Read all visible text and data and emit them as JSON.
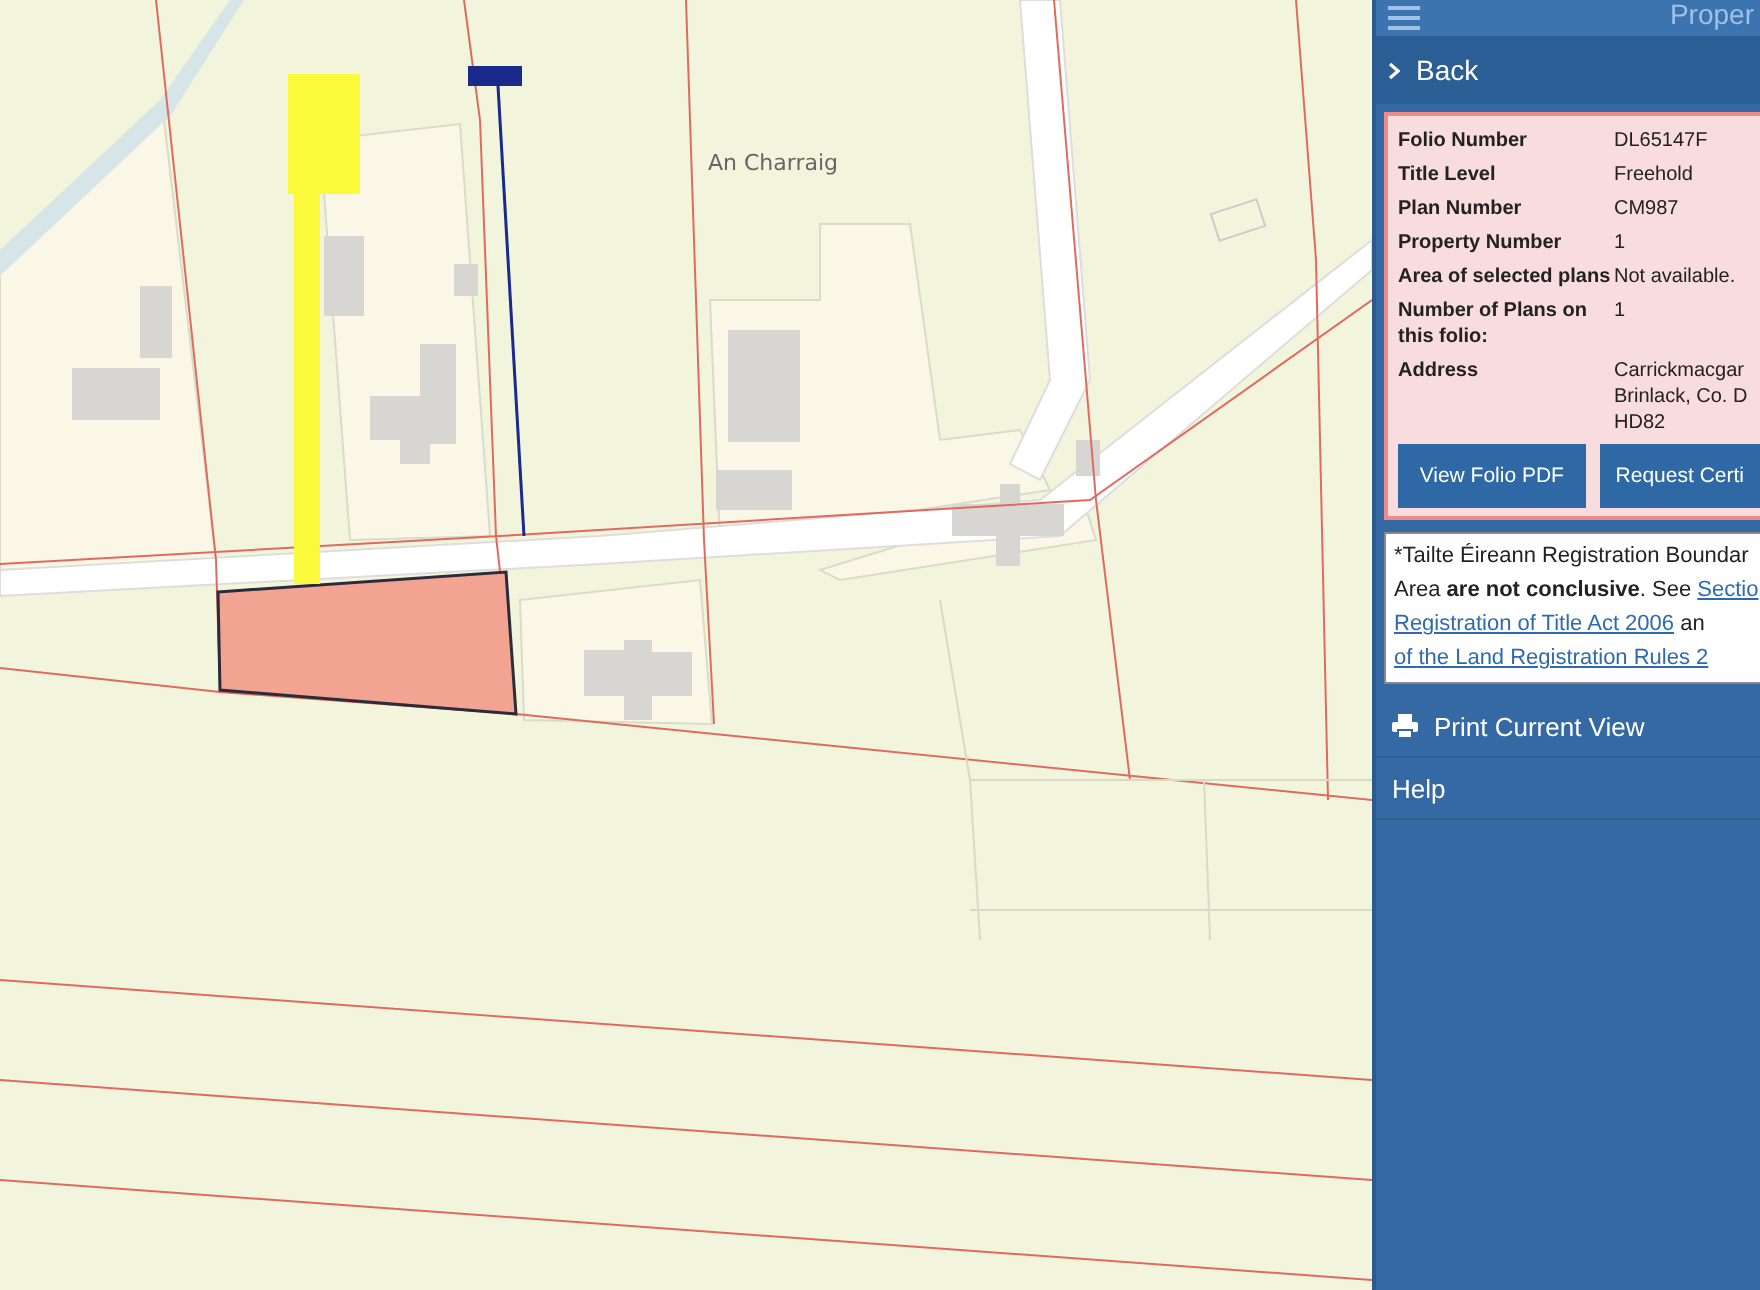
{
  "map": {
    "place_label": "An Charraig"
  },
  "sidebar": {
    "title": "Proper",
    "back": "Back",
    "details": [
      {
        "label": "Folio Number",
        "value": [
          "DL65147F"
        ]
      },
      {
        "label": "Title Level",
        "value": [
          "Freehold"
        ]
      },
      {
        "label": "Plan Number",
        "value": [
          "CM987"
        ]
      },
      {
        "label": "Property Number",
        "value": [
          "1"
        ]
      },
      {
        "label": "Area of selected plans",
        "value": [
          "Not available."
        ]
      },
      {
        "label": "Number of Plans on this folio:",
        "value": [
          "1"
        ]
      },
      {
        "label": "Address",
        "value": [
          "Carrickmacgar",
          "Brinlack, Co. D",
          "HD82"
        ]
      }
    ],
    "buttons": [
      "View Folio PDF",
      "Request Certi"
    ],
    "disclaimer": [
      [
        {
          "kind": "text",
          "text": "*Tailte Éireann Registration Boundar"
        }
      ],
      [
        {
          "kind": "text",
          "text": "Area "
        },
        {
          "kind": "bold",
          "text": "are not conclusive"
        },
        {
          "kind": "text",
          "text": ". See "
        },
        {
          "kind": "link",
          "text": "Sectio"
        }
      ],
      [
        {
          "kind": "link",
          "text": "Registration of Title Act 2006"
        },
        {
          "kind": "text",
          "text": " an"
        }
      ],
      [
        {
          "kind": "link",
          "text": "of the Land Registration Rules 2"
        }
      ]
    ],
    "menu": [
      {
        "kind": "print",
        "label": "Print Current View"
      },
      {
        "kind": "plain",
        "label": "Help"
      }
    ]
  }
}
